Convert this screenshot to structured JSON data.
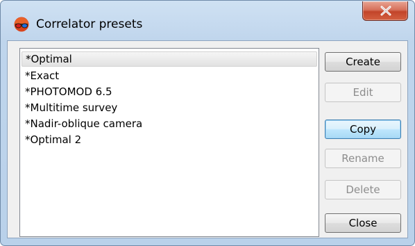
{
  "window": {
    "title": "Correlator presets",
    "close_symbol": "x"
  },
  "presets": [
    {
      "label": "*Optimal",
      "selected": true
    },
    {
      "label": "*Exact",
      "selected": false
    },
    {
      "label": "*PHOTOMOD 6.5",
      "selected": false
    },
    {
      "label": "*Multitime survey",
      "selected": false
    },
    {
      "label": "*Nadir-oblique camera",
      "selected": false
    },
    {
      "label": "*Optimal 2",
      "selected": false
    }
  ],
  "buttons": {
    "create": {
      "label": "Create",
      "enabled": true
    },
    "edit": {
      "label": "Edit",
      "enabled": false
    },
    "copy": {
      "label": "Copy",
      "enabled": true
    },
    "rename": {
      "label": "Rename",
      "enabled": false
    },
    "delete": {
      "label": "Delete",
      "enabled": false
    },
    "close": {
      "label": "Close",
      "enabled": true
    }
  },
  "icons": {
    "app": "stereo-glasses-icon",
    "close": "close-icon"
  }
}
